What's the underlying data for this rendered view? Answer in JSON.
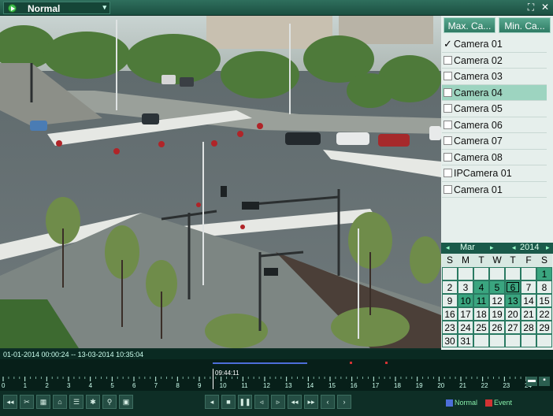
{
  "titlebar": {
    "mode_label": "Normal",
    "mode_icon": "play-icon",
    "controls": [
      "fullscreen-icon",
      "close-icon"
    ]
  },
  "camera_panel": {
    "max_button": "Max. Ca...",
    "min_button": "Min. Ca...",
    "cameras": [
      {
        "label": "Camera 01",
        "checked": true,
        "selected": false
      },
      {
        "label": "Camera 02",
        "checked": false,
        "selected": false
      },
      {
        "label": "Camera 03",
        "checked": false,
        "selected": false
      },
      {
        "label": "Camera 04",
        "checked": false,
        "selected": true
      },
      {
        "label": "Camera 05",
        "checked": false,
        "selected": false
      },
      {
        "label": "Camera 06",
        "checked": false,
        "selected": false
      },
      {
        "label": "Camera 07",
        "checked": false,
        "selected": false
      },
      {
        "label": "Camera 08",
        "checked": false,
        "selected": false
      },
      {
        "label": "IPCamera 01",
        "checked": false,
        "selected": false
      },
      {
        "label": "Camera 01",
        "checked": false,
        "selected": false
      }
    ]
  },
  "calendar": {
    "month": "Mar",
    "year": "2014",
    "weekdays": [
      "S",
      "M",
      "T",
      "W",
      "T",
      "F",
      "S"
    ],
    "leading_blanks": 6,
    "days": 31,
    "recorded_days": [
      1,
      4,
      5,
      10,
      11,
      13
    ],
    "selected_day": 6,
    "colors": {
      "recorded": "#3aa57f",
      "header": "#1a5a4a"
    }
  },
  "status": {
    "date_range": "01-01-2014 00:00:24 -- 13-03-2014 10:35:04"
  },
  "timeline": {
    "cursor_time": "09:44:11",
    "hours": [
      "0",
      "1",
      "2",
      "3",
      "4",
      "5",
      "6",
      "7",
      "8",
      "9",
      "10",
      "11",
      "12",
      "13",
      "14",
      "15",
      "16",
      "17",
      "18",
      "19",
      "20",
      "21",
      "22",
      "23",
      "24"
    ],
    "record_color": "#4d6ed9",
    "event_color": "#d23333"
  },
  "toolbar": {
    "left_icons": [
      "audio-icon",
      "clip-icon",
      "lock-icon",
      "tag-icon",
      "tag-manage-icon",
      "settings-icon",
      "zoom-icon",
      "snapshot-icon"
    ],
    "playback_icons": [
      "reverse-play-icon",
      "stop-icon",
      "pause-icon",
      "slow-icon",
      "fast-icon",
      "rewind-icon",
      "forward-icon",
      "prev-day-icon",
      "next-day-icon"
    ],
    "legend": [
      {
        "label": "Normal",
        "color": "#4d6ed9"
      },
      {
        "label": "Event",
        "color": "#d23333"
      }
    ]
  }
}
